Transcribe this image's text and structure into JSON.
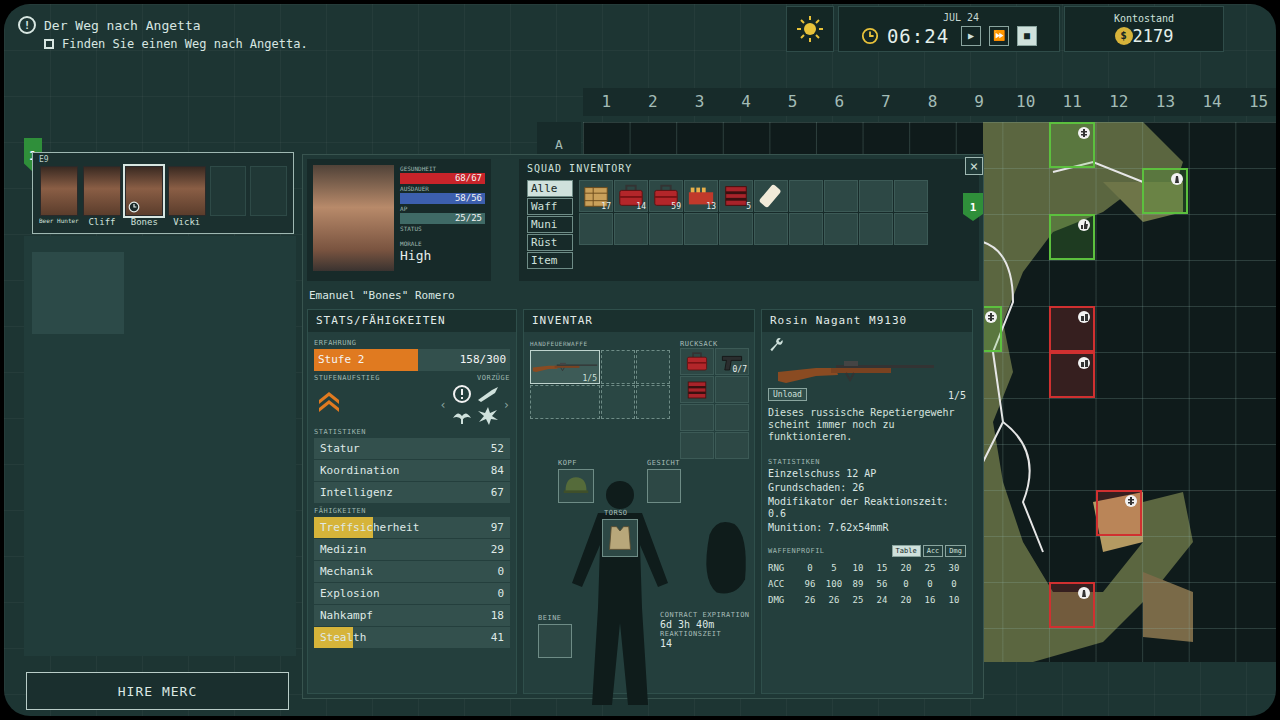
{
  "quest": {
    "icon": "!",
    "title": "Der Weg nach Angetta",
    "objectives": [
      {
        "text": "Finden Sie einen Weg nach Angetta.",
        "checked": false
      }
    ]
  },
  "clock": {
    "date": "JUL 24",
    "time": "06:24",
    "controls": [
      {
        "label": "▶",
        "selected": false
      },
      {
        "label": "⏩",
        "selected": false
      },
      {
        "label": "■",
        "selected": true
      }
    ]
  },
  "account": {
    "label": "Kontostand",
    "currency": "$",
    "amount": "2179"
  },
  "map": {
    "columns": [
      "1",
      "2",
      "3",
      "4",
      "5",
      "6",
      "7",
      "8",
      "9",
      "10",
      "11",
      "12",
      "13",
      "14",
      "15"
    ],
    "rows": [
      "A"
    ],
    "sectors": [
      {
        "kind": "money",
        "color": "#5cc03e"
      },
      {
        "kind": "tower",
        "color": "#5cc03e"
      },
      {
        "kind": "thumb",
        "color": "#5cc03e"
      },
      {
        "kind": "money",
        "color": "#5cc03e"
      },
      {
        "kind": "town",
        "color": "#d03030"
      },
      {
        "kind": "town",
        "color": "#d03030"
      },
      {
        "kind": "money",
        "color": "#d03030"
      },
      {
        "kind": "tower",
        "color": "#d03030"
      }
    ]
  },
  "squad": {
    "number": "1",
    "sector": "E9",
    "mercs": [
      {
        "name": "Beer Hunter",
        "selected": false
      },
      {
        "name": "Cliff",
        "selected": false
      },
      {
        "name": "Bones",
        "selected": true
      },
      {
        "name": "Vicki",
        "selected": false
      }
    ]
  },
  "hire_button": "HIRE MERC",
  "merc": {
    "name": "Emanuel \"Bones\" Romero",
    "bars": [
      {
        "label": "GESUNDHEIT",
        "reading": "68/67",
        "level": 1,
        "color": "#c8242a"
      },
      {
        "label": "AUSDAUER",
        "reading": "58/56",
        "level": 1,
        "color": "#3c5fae"
      },
      {
        "label": "AP",
        "reading": "25/25",
        "level": 1,
        "color": "#3f6a66"
      }
    ],
    "status_label": "STATUS",
    "morale_label": "MORALE",
    "morale": "High"
  },
  "squad_inventory": {
    "title": "SQUAD INVENTORY",
    "close": "×",
    "badge": "1",
    "tabs": [
      {
        "label": "Alle",
        "selected": true
      },
      {
        "label": "Waff",
        "selected": false
      },
      {
        "label": "Muni",
        "selected": false
      },
      {
        "label": "Rüst",
        "selected": false
      },
      {
        "label": "Item",
        "selected": false
      }
    ],
    "items": [
      {
        "kind": "crate",
        "count": "17"
      },
      {
        "kind": "medkit",
        "count": "14"
      },
      {
        "kind": "medkit",
        "count": "59"
      },
      {
        "kind": "ammo",
        "count": "13"
      },
      {
        "kind": "toolbox",
        "count": "5"
      },
      {
        "kind": "bandage",
        "count": ""
      }
    ]
  },
  "stats": {
    "title": "STATS/FÄHIGKEITEN",
    "experience_label": "ERFAHRUNG",
    "rank": "Stufe 2",
    "xp": "158/300",
    "xp_level": 0.53,
    "levelup_label": "STUFENAUFSTIEG",
    "perks_label": "VORZÜGE",
    "perk_prev": "‹",
    "perk_next": "›",
    "perks": [
      {
        "kind": "alert"
      },
      {
        "kind": "bullet"
      },
      {
        "kind": "bird"
      },
      {
        "kind": "burst"
      }
    ],
    "attributes_label": "STATISTIKEN",
    "attributes": [
      {
        "name": "Statur",
        "value": "52"
      },
      {
        "name": "Koordination",
        "value": "84"
      },
      {
        "name": "Intelligenz",
        "value": "67"
      }
    ],
    "skills_label": "FÄHIGKEITEN",
    "skills": [
      {
        "name": "Treffsicherheit",
        "value": "97",
        "level": 0.3
      },
      {
        "name": "Medizin",
        "value": "29",
        "level": 0
      },
      {
        "name": "Mechanik",
        "value": "0",
        "level": 0
      },
      {
        "name": "Explosion",
        "value": "0",
        "level": 0
      },
      {
        "name": "Nahkampf",
        "value": "18",
        "level": 0
      },
      {
        "name": "Stealth",
        "value": "41",
        "level": 0.2
      }
    ]
  },
  "inventory": {
    "title": "INVENTAR",
    "weapon_label": "HANDFEUERWAFFE",
    "weapon_ammo": "1/5",
    "backpack_label": "RUCKSACK",
    "backpack": [
      {
        "kind": "medkit",
        "count": ""
      },
      {
        "kind": "pistol",
        "count": "0/7"
      },
      {
        "kind": "toolbox",
        "count": ""
      }
    ],
    "head_label": "KOPF",
    "face_label": "GESICHT",
    "torso_label": "TORSO",
    "legs_label": "BEINE",
    "contract_label": "CONTRACT EXPIRATION",
    "contract": "6d 3h 40m",
    "reaction_label": "REAKTIONSZEIT",
    "reaction": "14"
  },
  "weapon": {
    "name": "Rosin Nagant M9130",
    "unload": "Unload",
    "ammo": "1/5",
    "description": "Dieses russische Repetiergewehr scheint immer noch zu funktionieren.",
    "stats_label": "STATISTIKEN",
    "stats": [
      {
        "label": "Einzelschuss",
        "value": "12 AP"
      },
      {
        "label": "Grundschaden:",
        "value": "26"
      },
      {
        "label": "Modifikator der Reaktionszeit:",
        "value": "0.6"
      },
      {
        "label": "Munition:",
        "value": "7.62x54mmR"
      }
    ],
    "profile_label": "WAFFENPROFIL",
    "profile_tabs": [
      {
        "label": "Table",
        "selected": true
      },
      {
        "label": "Acc",
        "selected": false
      },
      {
        "label": "Dmg",
        "selected": false
      }
    ],
    "table": [
      [
        "RNG",
        "0",
        "5",
        "10",
        "15",
        "20",
        "25",
        "30"
      ],
      [
        "ACC",
        "96",
        "100",
        "89",
        "56",
        "0",
        "0",
        "0"
      ],
      [
        "DMG",
        "26",
        "26",
        "25",
        "24",
        "20",
        "16",
        "10"
      ]
    ]
  }
}
